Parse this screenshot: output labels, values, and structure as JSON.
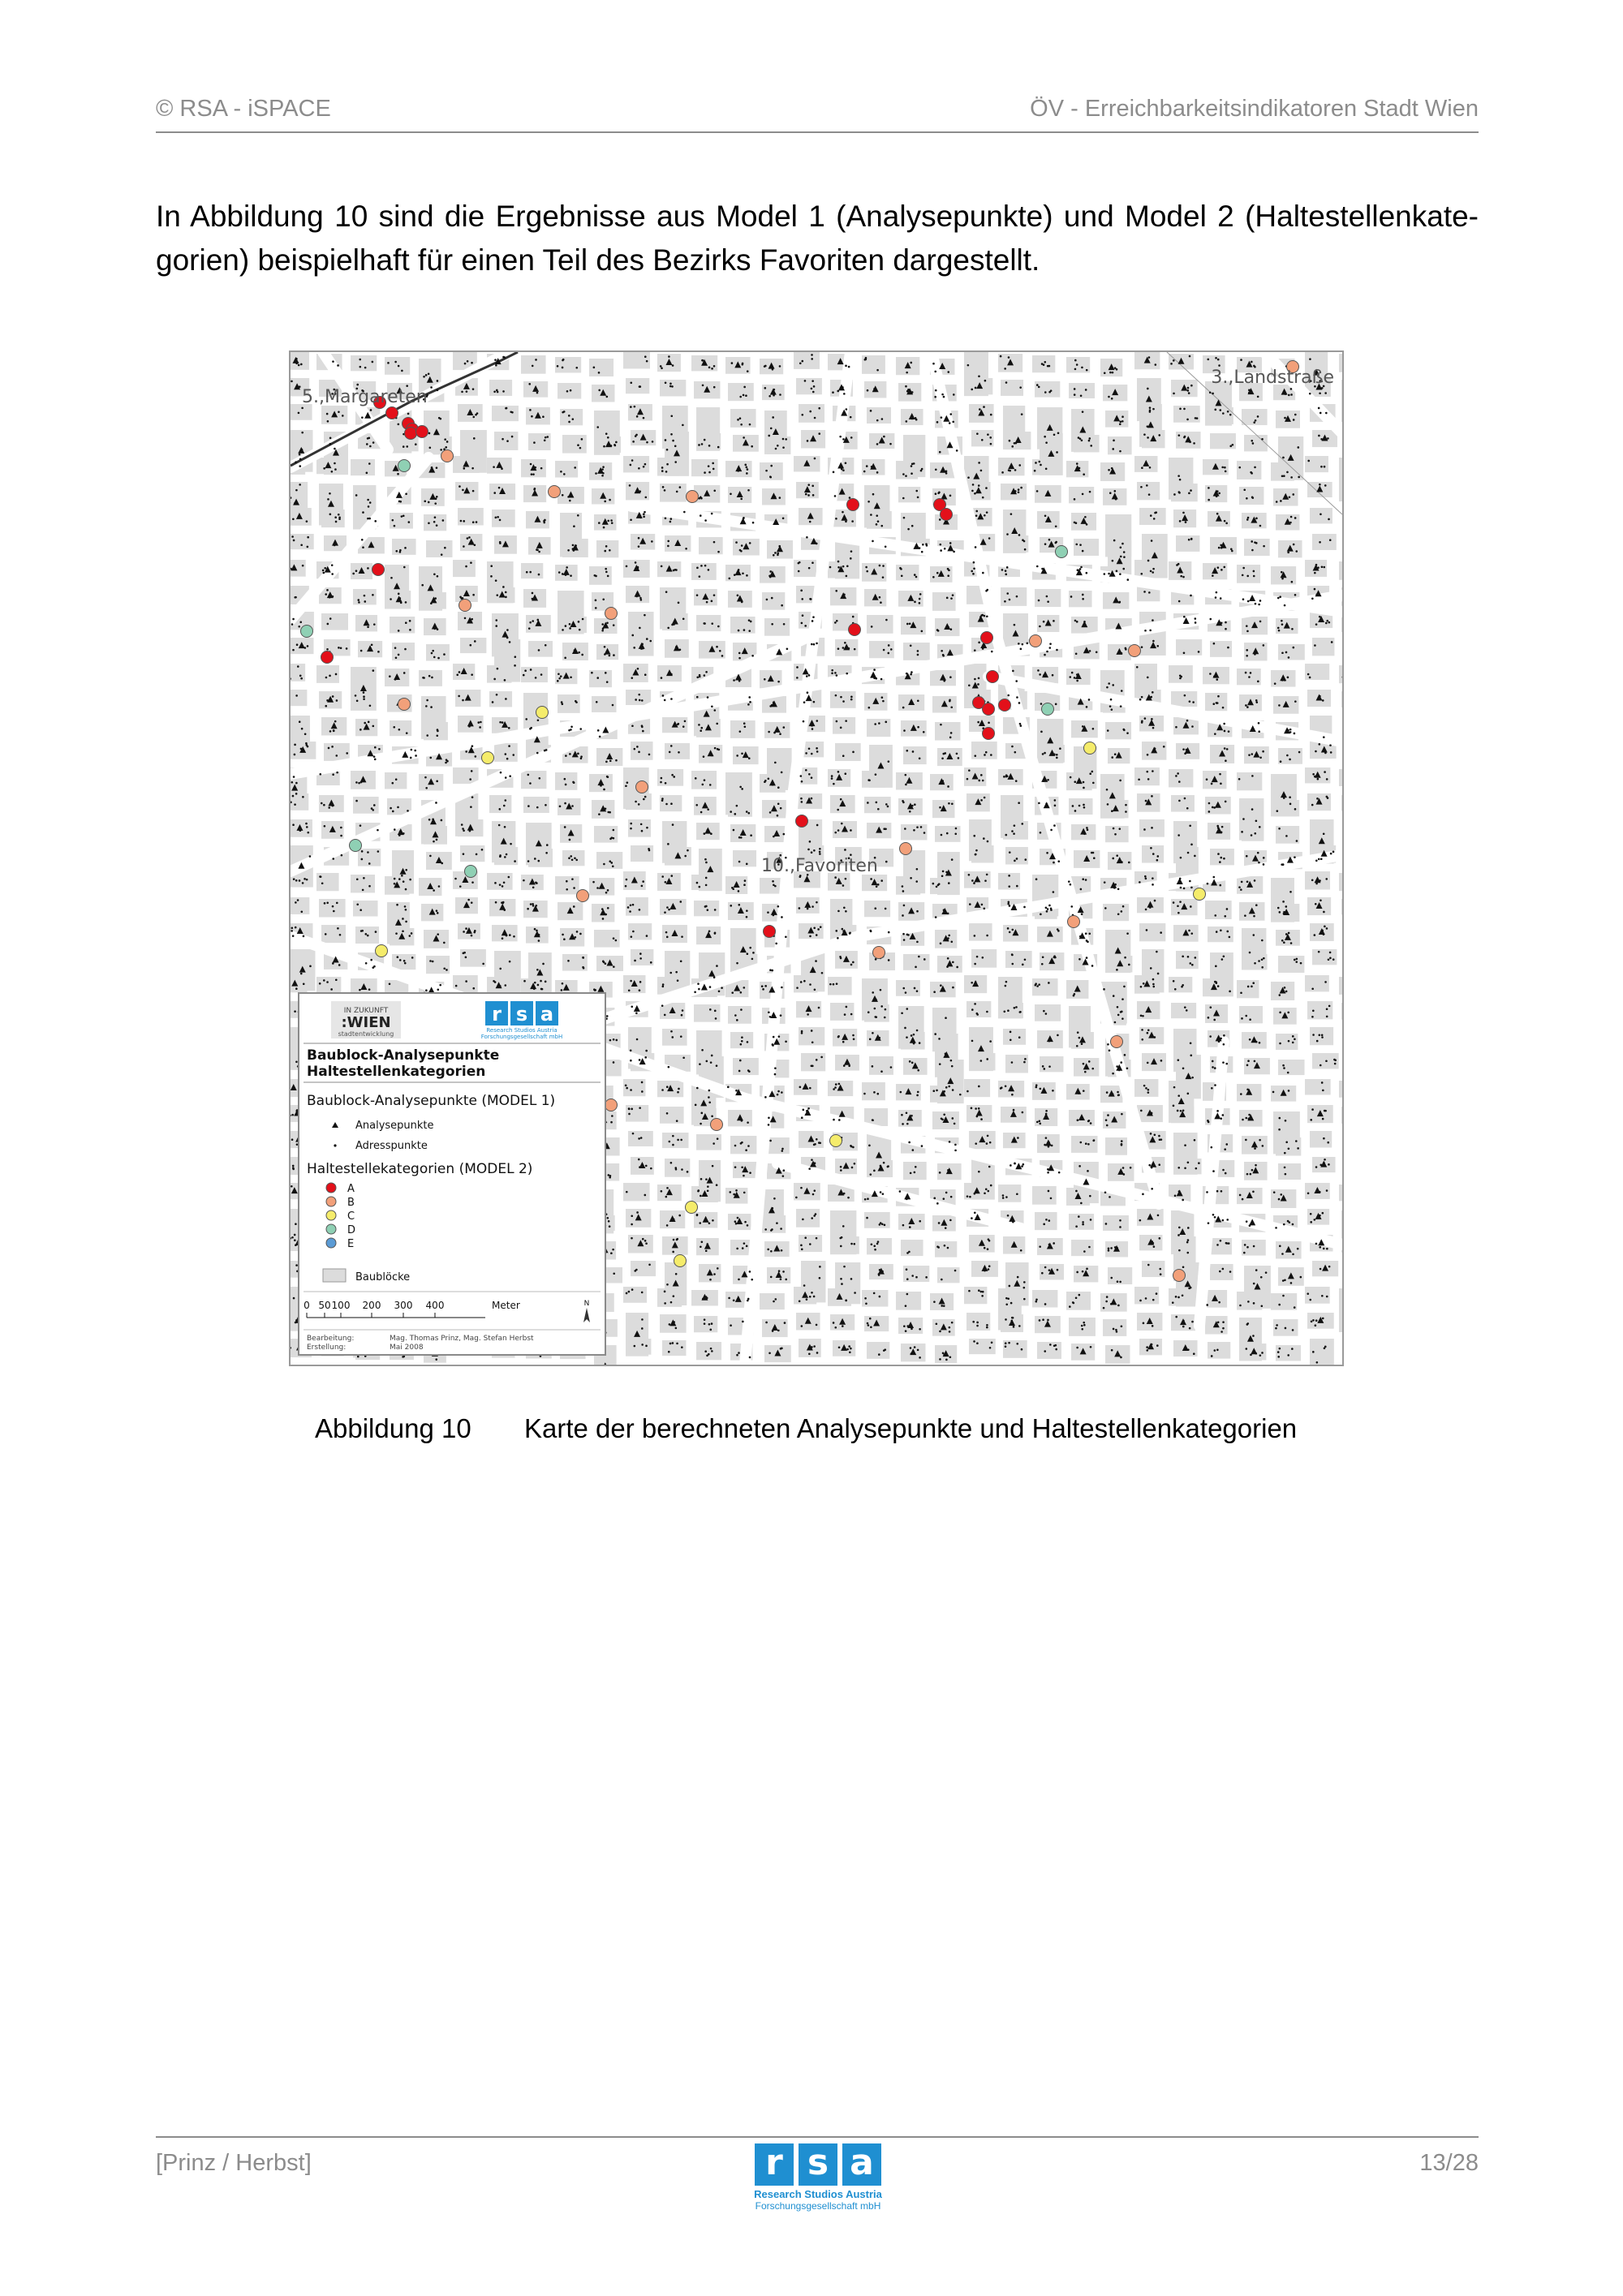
{
  "header": {
    "left": "© RSA - iSPACE",
    "right": "ÖV - Erreichbarkeitsindikatoren Stadt Wien"
  },
  "intro": {
    "line1": "In Abbildung 10 sind die Ergebnisse aus Model 1 (Analysepunkte) und Model 2 (Haltestellenkate-",
    "line2": "gorien) beispielhaft für einen Teil des Bezirks Favoriten dargestellt."
  },
  "map": {
    "districts": {
      "margareten": "5.,Margareten",
      "landstrasse": "3.,Landstraße",
      "favoriten": "10.,Favoriten"
    },
    "legend": {
      "logo_wien_top": "IN ZUKUNFT",
      "logo_wien": ":WIEN",
      "logo_wien_sub": "stadtentwicklung",
      "logo_rsa_letters": [
        "r",
        "s",
        "a"
      ],
      "logo_rsa_sub1": "Research Studios Austria",
      "logo_rsa_sub2": "Forschungsgesellschaft mbH",
      "title_line1": "Baublock-Analysepunkte",
      "title_line2": "Haltestellenkategorien",
      "model1_heading": "Baublock-Analysepunkte (MODEL 1)",
      "analysepunkte": "Analysepunkte",
      "adresspunkte": "Adresspunkte",
      "model2_heading": "Haltestellekategorien (MODEL 2)",
      "categories": [
        {
          "label": "A",
          "color": "#e3101a"
        },
        {
          "label": "B",
          "color": "#f2a07a"
        },
        {
          "label": "C",
          "color": "#f5ec6b"
        },
        {
          "label": "D",
          "color": "#8fd0b4"
        },
        {
          "label": "E",
          "color": "#5b9bd5"
        }
      ],
      "baubloecke": "Baublöcke",
      "scale_ticks": [
        "0",
        "50",
        "100",
        "200",
        "300",
        "400"
      ],
      "scale_unit": "Meter",
      "north": "N",
      "bearbeitung_label": "Bearbeitung:",
      "bearbeitung_value": "Mag. Thomas Prinz, Mag. Stefan Herbst",
      "erstellung_label": "Erstellung:",
      "erstellung_value": "Mai 2008"
    },
    "colors": {
      "background": "#ffffff",
      "blocks": "#dcdcdc",
      "cat_A": "#e3101a",
      "cat_B": "#f2a07a",
      "cat_C": "#f5ec6b",
      "cat_D": "#8fd0b4"
    }
  },
  "caption": {
    "number": "Abbildung 10",
    "text": "Karte der berechneten Analysepunkte und Haltestellenkategorien"
  },
  "footer": {
    "left": "[Prinz / Herbst]",
    "right": "13/28",
    "logo_letters": [
      "r",
      "s",
      "a"
    ],
    "logo_line1": "Research Studios Austria",
    "logo_line2": "Forschungsgesellschaft mbH"
  }
}
